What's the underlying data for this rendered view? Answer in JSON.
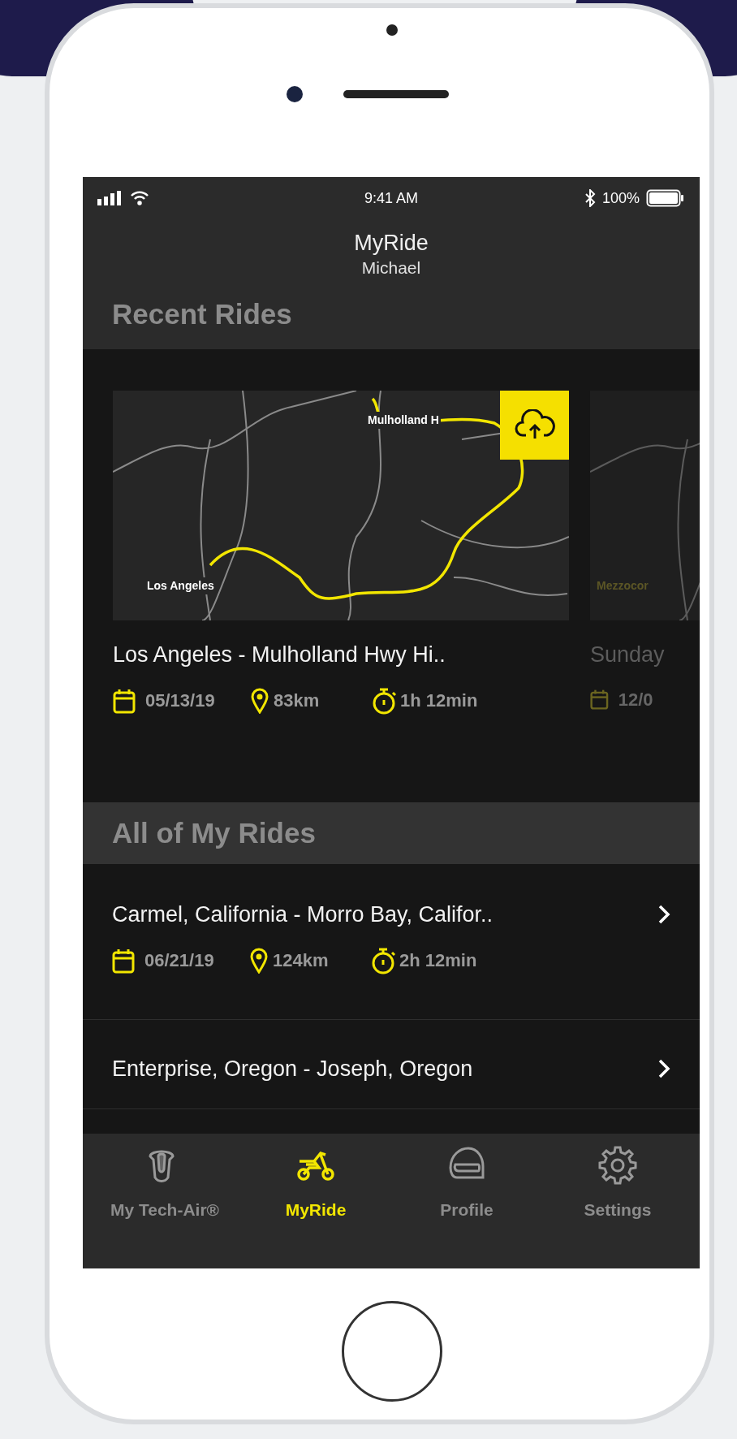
{
  "status_bar": {
    "time": "9:41 AM",
    "battery": "100%"
  },
  "header": {
    "title": "MyRide",
    "subtitle": "Michael"
  },
  "recent_rides": {
    "heading": "Recent Rides",
    "cards": [
      {
        "map_labels": [
          {
            "kind": "route_end",
            "text": "Mulholland H"
          },
          {
            "kind": "route_start",
            "text": "Los Angeles"
          }
        ],
        "upload": true,
        "title": "Los Angeles - Mulholland Hwy Hi..",
        "date": "05/13/19",
        "distance": "83km",
        "duration": "1h 12min"
      },
      {
        "map_labels": [
          {
            "kind": "route_start",
            "text": "Mezzocor"
          }
        ],
        "upload": false,
        "title": "Sunday",
        "date": "12/0"
      }
    ]
  },
  "all_rides": {
    "heading": "All of My Rides",
    "rows": [
      {
        "title": "Carmel, California - Morro Bay, Califor..",
        "date": "06/21/19",
        "distance": "124km",
        "duration": "2h 12min"
      },
      {
        "title": "Enterprise, Oregon - Joseph, Oregon"
      }
    ]
  },
  "tabs": [
    {
      "label": "My Tech-Air®",
      "selected": false
    },
    {
      "label": "MyRide",
      "selected": true
    },
    {
      "label": "Profile",
      "selected": false
    },
    {
      "label": "Settings",
      "selected": false
    }
  ]
}
